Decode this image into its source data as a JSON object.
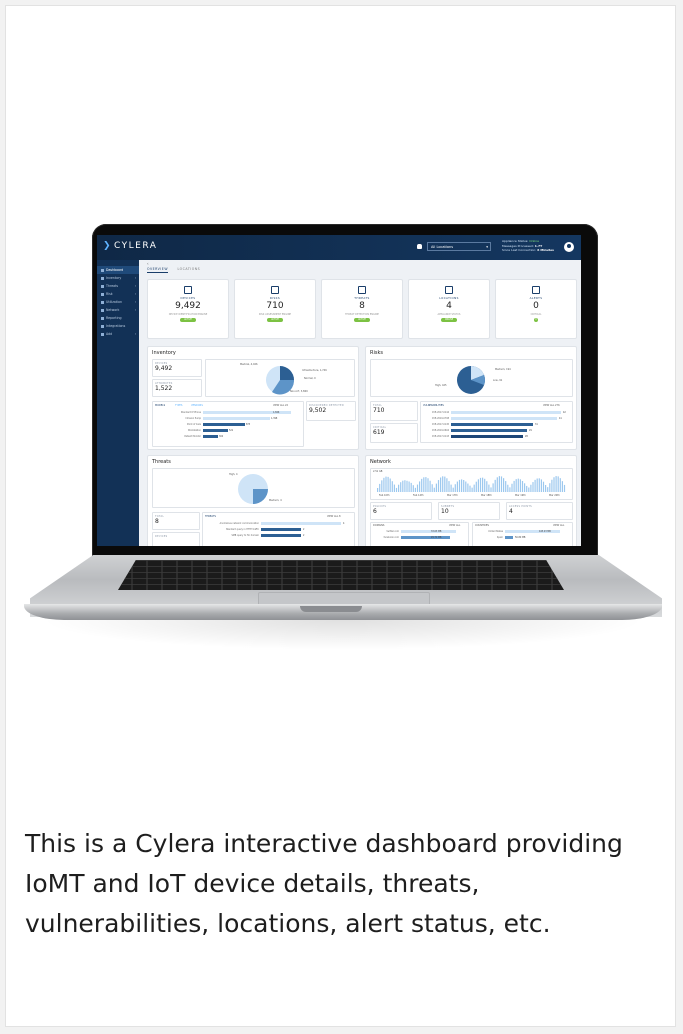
{
  "app": {
    "logo": "CYLERA",
    "location_select": "All Locations",
    "system_status": {
      "status_label": "Appliance Status:",
      "status_value": "Online",
      "messages_label": "Messages Processed:",
      "messages_value": "1.7T",
      "last_conn_label": "Since Last Connection:",
      "last_conn_value": "6 Minutes"
    }
  },
  "sidebar": {
    "items": [
      {
        "label": "Dashboard",
        "active": true
      },
      {
        "label": "Inventory"
      },
      {
        "label": "Threats"
      },
      {
        "label": "Risk"
      },
      {
        "label": "Utilization"
      },
      {
        "label": "Network"
      },
      {
        "label": "Reporting"
      },
      {
        "label": "Integrations"
      },
      {
        "label": "Add"
      }
    ]
  },
  "tabs": {
    "overview": "OVERVIEW",
    "locations": "LOCATIONS"
  },
  "summary": [
    {
      "label": "DEVICES",
      "value": "9,492",
      "sub": "DEVICE IDENTIFICATION ENGINE",
      "pill": "ACTIVE",
      "icon": "monitor-icon"
    },
    {
      "label": "RISKS",
      "value": "710",
      "sub": "RISK ASSESSMENT ENGINE",
      "pill": "ACTIVE",
      "icon": "shield-icon"
    },
    {
      "label": "THREATS",
      "value": "8",
      "sub": "THREAT DETECTION ENGINE",
      "pill": "ACTIVE",
      "icon": "bug-icon"
    },
    {
      "label": "LOCATIONS",
      "value": "4",
      "sub": "APPLIANCE STATUS",
      "pill": "ONLINE",
      "icon": "building-icon"
    },
    {
      "label": "ALERTS",
      "value": "0",
      "sub": "CRITICAL",
      "pill": "0",
      "icon": "bell-icon"
    }
  ],
  "inventory": {
    "title": "Inventory",
    "devices_label": "DEVICES",
    "devices_value": "9,492",
    "attributes_label": "ATTRIBUTES",
    "attributes_value": "1,522",
    "pie_labels": [
      "Medical, 4,026",
      "Infrastructure, 1,746",
      "Normal, 0",
      "Non-IoT, 3,869"
    ],
    "models_tab": "MODELS",
    "types_tab": "TYPES",
    "vendors_tab": "VENDORS",
    "view_all": "VIEW ALL 22",
    "discovered_label": "DISCOVERED DETECTED",
    "discovered_value": "9,502",
    "bars": [
      {
        "label": "Standard IP Phone",
        "value": "1,846"
      },
      {
        "label": "Infusion Pump",
        "value": "1,398"
      },
      {
        "label": "Point of Care",
        "value": "873"
      },
      {
        "label": "Workstation",
        "value": "521"
      },
      {
        "label": "Patient Monitor",
        "value": "302"
      }
    ]
  },
  "risks": {
    "title": "Risks",
    "pie_labels": [
      "Medium, 194",
      "Low, 91",
      "High, 425"
    ],
    "total_label": "TOTAL",
    "total_value": "710",
    "critical_label": "CRITICAL",
    "critical_value": "619",
    "vuln_tab": "VULNERABILITIES",
    "view_all": "VIEW ALL 276",
    "bars": [
      {
        "label": "CVE-2017-0144",
        "value": "42"
      },
      {
        "label": "CVE-2019-0708",
        "value": "41"
      },
      {
        "label": "CVE-2017-0145",
        "value": "31"
      },
      {
        "label": "CVE-2019-0604",
        "value": "29"
      },
      {
        "label": "CVE-2017-0143",
        "value": "28"
      }
    ]
  },
  "threats": {
    "title": "Threats",
    "pie_labels": [
      "High, 4",
      "Medium, 4"
    ],
    "total_label": "TOTAL",
    "total_value": "8",
    "devices_label": "DEVICES",
    "threats_tab": "THREATS",
    "view_all": "VIEW ALL 8",
    "bars": [
      {
        "label": "Anomalous network communication",
        "value": "4"
      },
      {
        "label": "Standard query in HTTP traffic",
        "value": "2"
      },
      {
        "label": "SMB query to Tor domain",
        "value": "2"
      }
    ]
  },
  "network": {
    "title": "Network",
    "top_label": "2.5k GB",
    "axis_labels": [
      "Feb 10th",
      "Feb 14th",
      "Mar 17th",
      "Mar 18th",
      "Mar 19th",
      "Mar 20th"
    ],
    "policies_label": "POLICIES",
    "policies_value": "6",
    "subnets_label": "SUBNETS",
    "subnets_value": "10",
    "access_label": "ACCESS POINTS",
    "access_value": "4",
    "domains_label": "DOMAINS",
    "domains_view": "VIEW ALL",
    "countries_label": "COUNTRIES",
    "countries_view": "VIEW ALL",
    "domain_rows": [
      {
        "label": "twitter.com",
        "value": "33.63 MB"
      },
      {
        "label": "facebook.com",
        "value": "29.71 MB"
      }
    ],
    "country_rows": [
      {
        "label": "United States",
        "value": "445.23 MB"
      },
      {
        "label": "Spain",
        "value": "56.80 MB"
      }
    ]
  },
  "caption": "This is a Cylera interactive dashboard providing IoMT and IoT device details, threats, vulnerabilities, locations, alert status, etc.",
  "colors": {
    "navy": "#143760",
    "accent": "#5fb3ff",
    "green": "#7cc243",
    "bar_light": "#cfe4f7",
    "bar_dark": "#2c5f93"
  }
}
